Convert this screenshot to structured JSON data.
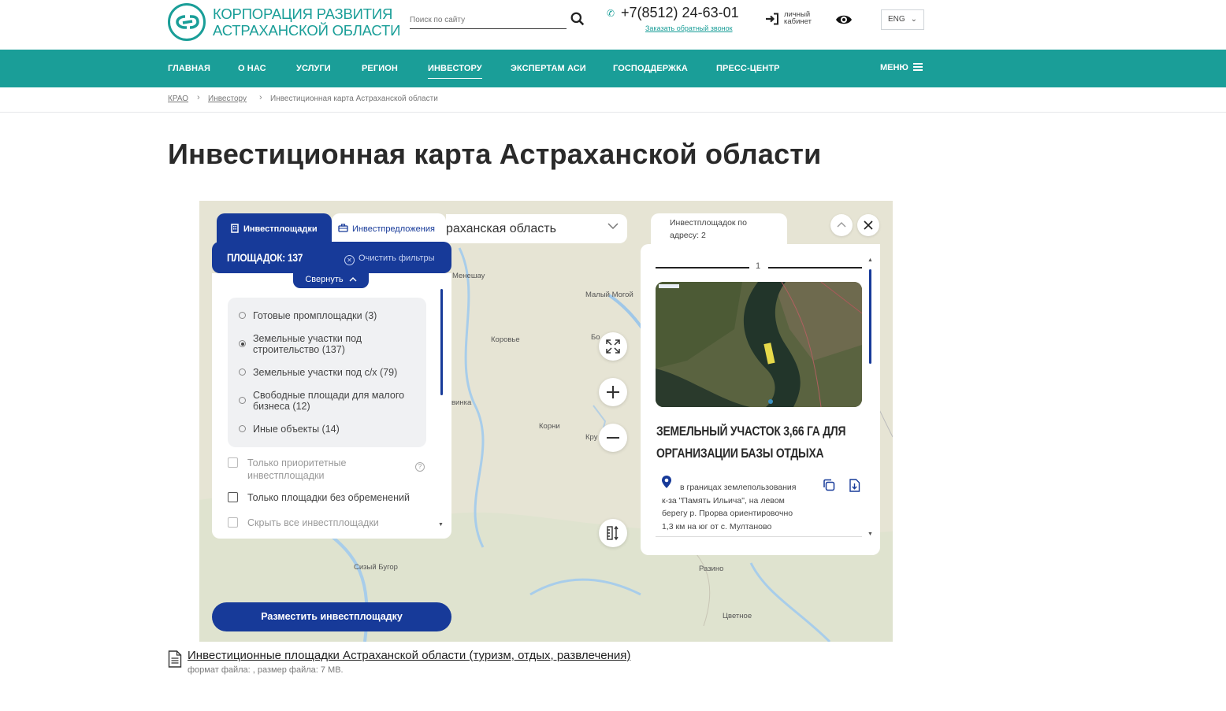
{
  "header": {
    "logo_line1": "КОРПОРАЦИЯ РАЗВИТИЯ",
    "logo_line2": "АСТРАХАНСКОЙ ОБЛАСТИ",
    "search_placeholder": "Поиск по сайту",
    "phone": "+7(8512) 24-63-01",
    "callback": "Заказать обратный звонок",
    "cabinet": "личный кабинет",
    "lang": "ENG"
  },
  "nav": {
    "items": [
      "ГЛАВНАЯ",
      "О НАС",
      "УСЛУГИ",
      "РЕГИОН",
      "ИНВЕСТОРУ",
      "ЭКСПЕРТАМ АСИ",
      "ГОСПОДДЕРЖКА",
      "ПРЕСС-ЦЕНТР"
    ],
    "active": "ИНВЕСТОРУ",
    "menu": "МЕНЮ"
  },
  "breadcrumb": [
    "КРАО",
    "Инвестору",
    "Инвестиционная карта Астраханской области"
  ],
  "page_title": "Инвестиционная карта Астраханской области",
  "map": {
    "tab_sites": "Инвестплощадки",
    "tab_offers": "Инвестпредложения",
    "region": "раханская область",
    "count_label": "ПЛОЩАДОК: 137",
    "clear_filters": "Очистить фильтры",
    "collapse": "Свернуть",
    "categories": [
      {
        "label": "Готовые промплощадки (3)",
        "selected": false
      },
      {
        "label": "Земельные участки под",
        "label2": "строительство (137)",
        "selected": true
      },
      {
        "label": "Земельные участки под с/х (79)",
        "selected": false
      },
      {
        "label": "Свободные площади для малого",
        "label2": "бизнеса (12)",
        "selected": false
      },
      {
        "label": "Иные объекты (14)",
        "selected": false
      }
    ],
    "checks": {
      "priority_1": "Только приоритетные",
      "priority_2": "инвестплощадки",
      "no_encumbrance": "Только площадки без обременений",
      "hide_all": "Скрыть все инвестплощадки"
    },
    "place_button": "Разместить инвестплощадку",
    "places": [
      "Менешау",
      "Малый Могой",
      "Коровье",
      "Бо",
      "винка",
      "Корни",
      "Кру",
      "Сизый Бугор",
      "Разино",
      "Цветное"
    ],
    "card": {
      "tab_line1": "Инвестплощадок по",
      "tab_line2": "адресу: 2",
      "index": "1",
      "title_line1": "Земельный участок 3,66 га для",
      "title_line2": "организации базы отдыха",
      "addr_1": "в границах землепользования",
      "addr_2": "к-за \"Память Ильича\", на левом",
      "addr_3": "берегу р. Прорва ориентировочно",
      "addr_4": "1,3 км на юг от с. Мултаново"
    }
  },
  "file": {
    "link": "Инвестиционные площадки Астраханской области (туризм, отдых, развлечения)",
    "meta": "формат файла: , размер файла: 7 MB."
  },
  "colors": {
    "teal": "#1a9e98",
    "navy": "#173a99"
  }
}
